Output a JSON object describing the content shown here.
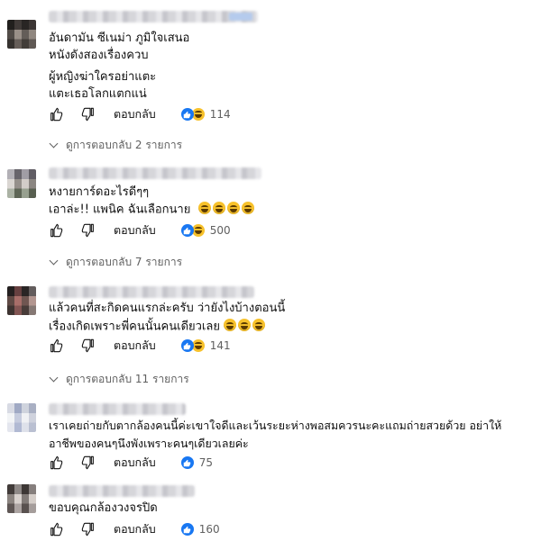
{
  "comments": [
    {
      "lines": [
        "อันดามัน ซีเนม่า ภูมิใจเสนอ",
        "หนังดังสองเรื่องควบ"
      ],
      "lines2": [
        "ผู้หญิงฆ่าใครอย่าแตะ",
        "แตะเธอโลกแตกแน่"
      ],
      "reply_label": "ตอบกลับ",
      "reaction_count": "114",
      "reactions": [
        "like-icon",
        "haha-icon"
      ],
      "view_replies": "ดูการตอบกลับ 2 รายการ"
    },
    {
      "lines": [
        "หงายการ์ดอะไรดีๆๆ",
        "เอาล่ะ!! แพนิค ฉันเลือกนาย"
      ],
      "reply_label": "ตอบกลับ",
      "reaction_count": "500",
      "reactions": [
        "like-icon",
        "haha-icon"
      ],
      "view_replies": "ดูการตอบกลับ 7 รายการ"
    },
    {
      "lines": [
        "แล้วคนที่สะกิดคนแรกล่ะครับ ว่ายังไงบ้างตอนนี้",
        "เรื่องเกิดเพราะพี่คนนั้นคนเดียวเลย"
      ],
      "reply_label": "ตอบกลับ",
      "reaction_count": "141",
      "reactions": [
        "like-icon",
        "haha-icon"
      ],
      "view_replies": "ดูการตอบกลับ 11 รายการ"
    },
    {
      "lines": [
        "เราเคยถ่ายกับตากล้องคนนี้ค่ะเขาใจดีและเว้นระยะห่างพอสมควรนะคะแถมถ่ายสวยด้วย อย่าให้",
        "อาชีพของคนๆนึงพังเพราะคนๆเดียวเลยค่ะ"
      ],
      "reply_label": "ตอบกลับ",
      "reaction_count": "75",
      "reactions": [
        "like-icon"
      ]
    },
    {
      "lines": [
        "ขอบคุณกล้องวงจรปิด"
      ],
      "reply_label": "ตอบกลับ",
      "reaction_count": "160",
      "reactions": [
        "like-icon"
      ]
    }
  ],
  "colors": {
    "like": "#1877f2",
    "haha": "#f7c12b",
    "text": "#0f0f0f",
    "muted": "#606060"
  }
}
